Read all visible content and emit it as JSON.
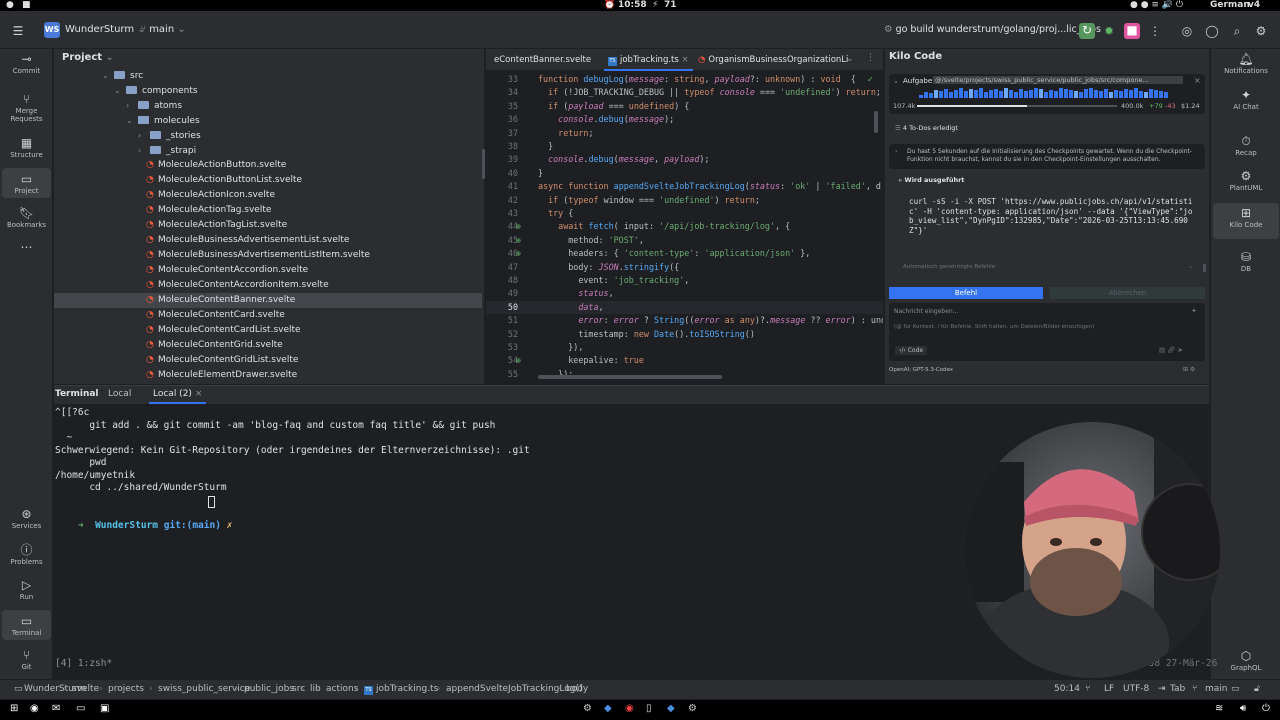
{
  "system": {
    "time": "10:58",
    "battery": "71",
    "keyboard": "German",
    "version": "v4"
  },
  "topbar": {
    "project_name": "WunderSturm",
    "project_badge": "WS",
    "branch": "main",
    "run_config": "go build wunderstrum/golang/proj...lic_jobs"
  },
  "leftstrip": {
    "items": [
      "Commit",
      "Merge Requests",
      "Structure",
      "Project",
      "Bookmarks"
    ],
    "bottom_items": [
      "Services",
      "Problems",
      "Run",
      "Terminal",
      "Git"
    ]
  },
  "project": {
    "title": "Project",
    "tree": [
      {
        "label": "src",
        "type": "folder",
        "open": true
      },
      {
        "label": "components",
        "type": "folder",
        "open": true
      },
      {
        "label": "atoms",
        "type": "folder",
        "open": false
      },
      {
        "label": "molecules",
        "type": "folder",
        "open": true
      },
      {
        "label": "_stories",
        "type": "folder",
        "open": false
      },
      {
        "label": "_strapi",
        "type": "folder",
        "open": false
      },
      {
        "label": "MoleculeActionButton.svelte",
        "type": "file"
      },
      {
        "label": "MoleculeActionButtonList.svelte",
        "type": "file"
      },
      {
        "label": "MoleculeActionIcon.svelte",
        "type": "file"
      },
      {
        "label": "MoleculeActionTag.svelte",
        "type": "file"
      },
      {
        "label": "MoleculeActionTagList.svelte",
        "type": "file"
      },
      {
        "label": "MoleculeBusinessAdvertisementList.svelte",
        "type": "file"
      },
      {
        "label": "MoleculeBusinessAdvertisementListItem.svelte",
        "type": "file"
      },
      {
        "label": "MoleculeContentAccordion.svelte",
        "type": "file"
      },
      {
        "label": "MoleculeContentAccordionItem.svelte",
        "type": "file"
      },
      {
        "label": "MoleculeContentBanner.svelte",
        "type": "file",
        "selected": true
      },
      {
        "label": "MoleculeContentCard.svelte",
        "type": "file"
      },
      {
        "label": "MoleculeContentCardList.svelte",
        "type": "file"
      },
      {
        "label": "MoleculeContentGrid.svelte",
        "type": "file"
      },
      {
        "label": "MoleculeContentGridList.svelte",
        "type": "file"
      },
      {
        "label": "MoleculeElementDrawer.svelte",
        "type": "file"
      }
    ]
  },
  "editor": {
    "tabs": [
      {
        "label": "eContentBanner.svelte",
        "active": false
      },
      {
        "label": "jobTracking.ts",
        "active": true
      },
      {
        "label": "OrganismBusinessOrganizationLi",
        "active": false
      }
    ],
    "lines": [
      {
        "n": "33",
        "code": "function debugLog(message: string, payload?: unknown) : void  {"
      },
      {
        "n": "34",
        "code": "  if (!JOB_TRACKING_DEBUG || typeof console === 'undefined') return;"
      },
      {
        "n": "35",
        "code": "  if (payload === undefined) {"
      },
      {
        "n": "36",
        "code": "    console.debug(message);"
      },
      {
        "n": "37",
        "code": "    return;"
      },
      {
        "n": "38",
        "code": "  }"
      },
      {
        "n": "39",
        "code": "  console.debug(message, payload);"
      },
      {
        "n": "40",
        "code": "}"
      },
      {
        "n": "41",
        "code": "async function appendSvelteJobTrackingLog(status: 'ok' | 'failed', d"
      },
      {
        "n": "42",
        "code": "  if (typeof window === 'undefined') return;"
      },
      {
        "n": "43",
        "code": "  try {"
      },
      {
        "n": "44",
        "code": "    await fetch( input: '/api/job-tracking/log', {"
      },
      {
        "n": "45",
        "code": "      method: 'POST',"
      },
      {
        "n": "46",
        "code": "      headers: { 'content-type': 'application/json' },"
      },
      {
        "n": "47",
        "code": "      body: JSON.stringify({"
      },
      {
        "n": "48",
        "code": "        event: 'job_tracking',"
      },
      {
        "n": "49",
        "code": "        status,"
      },
      {
        "n": "50",
        "code": "        data,"
      },
      {
        "n": "51",
        "code": "        error: error ? String((error as any)?.message ?? error) : und"
      },
      {
        "n": "52",
        "code": "        timestamp: new Date().toISOString()"
      },
      {
        "n": "53",
        "code": "      }),"
      },
      {
        "n": "54",
        "code": "      keepalive: true"
      },
      {
        "n": "55",
        "code": "    });"
      }
    ]
  },
  "kilo": {
    "title": "Kilo Code",
    "task_label": "Aufgabe:",
    "task_path": "@/svelte/projects/swiss_public_service/public_jobs/src/compone...",
    "stat_left": "107.4k",
    "stat_mid": "400.0k",
    "stat_plus": "+79",
    "stat_minus": "-43",
    "stat_cost": "$1.24",
    "todos": "4 To-Dos erledigt",
    "info_text": "Du hast 5 Sekunden auf die Initialisierung des Checkpoints gewartet. Wenn du die Checkpoint-Funktion nicht brauchst, kannst du sie in den Checkpoint-Einstellungen ausschalten.",
    "running": "Wird ausgeführt",
    "command": "curl -sS -i -X POST 'https://www.publicjobs.ch/api/v1/statistic' -H 'content-type: application/json' --data '{\"ViewType\":\"job_view_list\",\"DynPgID\":132985,\"Date\":\"2026-03-25T13:13:45.690Z\"}'",
    "auto_approved": "Automatisch genehmigte Befehle",
    "btn_command": "Befehl",
    "btn_cancel": "Abbrechen",
    "input_placeholder": "Nachricht eingeben...",
    "input_hint": "(@ für Kontext, / für Befehle, Shift halten, um Dateien/Bilder einzufügen)",
    "mode": "Code",
    "model": "OpenAI: GPT-5.3-Codex"
  },
  "rightstrip": {
    "items": [
      "Notifications",
      "AI Chat",
      "Recap",
      "PlantUML",
      "Kilo Code",
      "DB"
    ],
    "bottom": "GraphQL"
  },
  "terminal": {
    "tabs": [
      "Terminal",
      "Local",
      "Local (2)"
    ],
    "lines": [
      "^[[?6c",
      "      git add . && git commit -am 'blog-faq and custom faq title' && git push",
      "  ~",
      "Schwerwiegend: Kein Git-Repository (oder irgendeines der Elternverzeichnisse): .git",
      "      pwd",
      "/home/umyetnik",
      "      cd ../shared/WunderSturm"
    ],
    "prompt_dir": "WunderSturm",
    "prompt_git": "git:(main)",
    "prompt_x": "✗",
    "tmux": "[4] 1:zsh*",
    "tmux_right": "\"WorkStation16\" 10:58 27-Mär-26"
  },
  "statusbar": {
    "crumbs": [
      "WunderSturm",
      "svelte",
      "projects",
      "swiss_public_service",
      "public_jobs",
      "src",
      "lib",
      "actions",
      "jobTracking.ts",
      "appendSvelteJobTrackingLog()",
      "body"
    ],
    "position": "50:14",
    "line_ending": "LF",
    "encoding": "UTF-8",
    "indent": "Tab",
    "branch": "main"
  }
}
